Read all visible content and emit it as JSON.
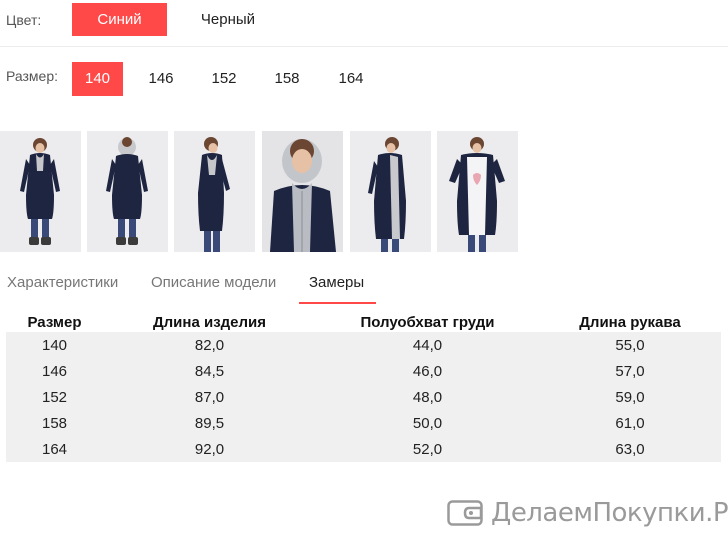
{
  "color_option": {
    "label": "Цвет:",
    "choices": [
      {
        "label": "Синий",
        "selected": true
      },
      {
        "label": "Черный",
        "selected": false
      }
    ]
  },
  "size_option": {
    "label": "Размер:",
    "choices": [
      {
        "label": "140",
        "selected": true
      },
      {
        "label": "146",
        "selected": false
      },
      {
        "label": "152",
        "selected": false
      },
      {
        "label": "158",
        "selected": false
      },
      {
        "label": "164",
        "selected": false
      }
    ]
  },
  "gallery": {
    "photos": [
      "front-view",
      "back-view",
      "side-view",
      "hood-closeup",
      "open-side-view",
      "open-front-view"
    ]
  },
  "tabs": [
    {
      "label": "Характеристики",
      "active": false
    },
    {
      "label": "Описание модели",
      "active": false
    },
    {
      "label": "Замеры",
      "active": true
    }
  ],
  "measurements": {
    "headers": [
      "Размер",
      "Длина изделия",
      "Полуобхват груди",
      "Длина рукава"
    ],
    "rows": [
      [
        "140",
        "82,0",
        "44,0",
        "55,0"
      ],
      [
        "146",
        "84,5",
        "46,0",
        "57,0"
      ],
      [
        "152",
        "87,0",
        "48,0",
        "59,0"
      ],
      [
        "158",
        "89,5",
        "50,0",
        "61,0"
      ],
      [
        "164",
        "92,0",
        "52,0",
        "63,0"
      ]
    ]
  },
  "watermark": {
    "text": "ДелаемПокупки.Ру",
    "icon": "wallet-icon"
  },
  "colors": {
    "accent": "#ff4949",
    "jacket": "#1e2540",
    "table_row": "#f0f0f0"
  }
}
